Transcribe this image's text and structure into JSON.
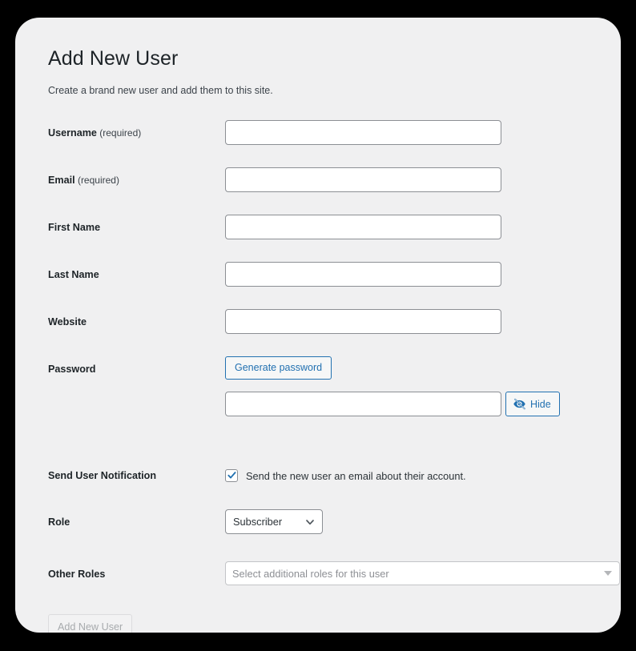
{
  "page": {
    "title": "Add New User",
    "subtitle": "Create a brand new user and add them to this site."
  },
  "form": {
    "fields": [
      {
        "label": "Username",
        "required_note": " (required)",
        "value": "",
        "placeholder": ""
      },
      {
        "label": "Email",
        "required_note": " (required)",
        "value": "",
        "placeholder": ""
      },
      {
        "label": "First Name",
        "required_note": "",
        "value": "",
        "placeholder": ""
      },
      {
        "label": "Last Name",
        "required_note": "",
        "value": "",
        "placeholder": ""
      },
      {
        "label": "Website",
        "required_note": "",
        "value": "",
        "placeholder": ""
      }
    ],
    "password": {
      "label": "Password",
      "generate_label": "Generate password",
      "value": "",
      "placeholder": "",
      "hide_label": "Hide",
      "hide_icon": "eye-slash-icon"
    },
    "notification": {
      "label": "Send User Notification",
      "checkbox_text": "Send the new user an email about their account.",
      "checked": true,
      "check_icon": "checkmark-icon"
    },
    "role": {
      "label": "Role",
      "selected": "Subscriber",
      "chevron_icon": "chevron-down-icon"
    },
    "other_roles": {
      "label": "Other Roles",
      "placeholder": "Select additional roles for this user",
      "caret_icon": "caret-down-icon"
    },
    "submit_label": "Add New User"
  },
  "colors": {
    "page_background": "#000000",
    "card_background": "#f0f0f1",
    "accent_blue": "#2271b1",
    "input_border": "#8c8f94",
    "heading": "#1d2327",
    "body_text": "#3c434a",
    "placeholder": "#8d8f94",
    "disabled_text": "#a7aaad"
  }
}
